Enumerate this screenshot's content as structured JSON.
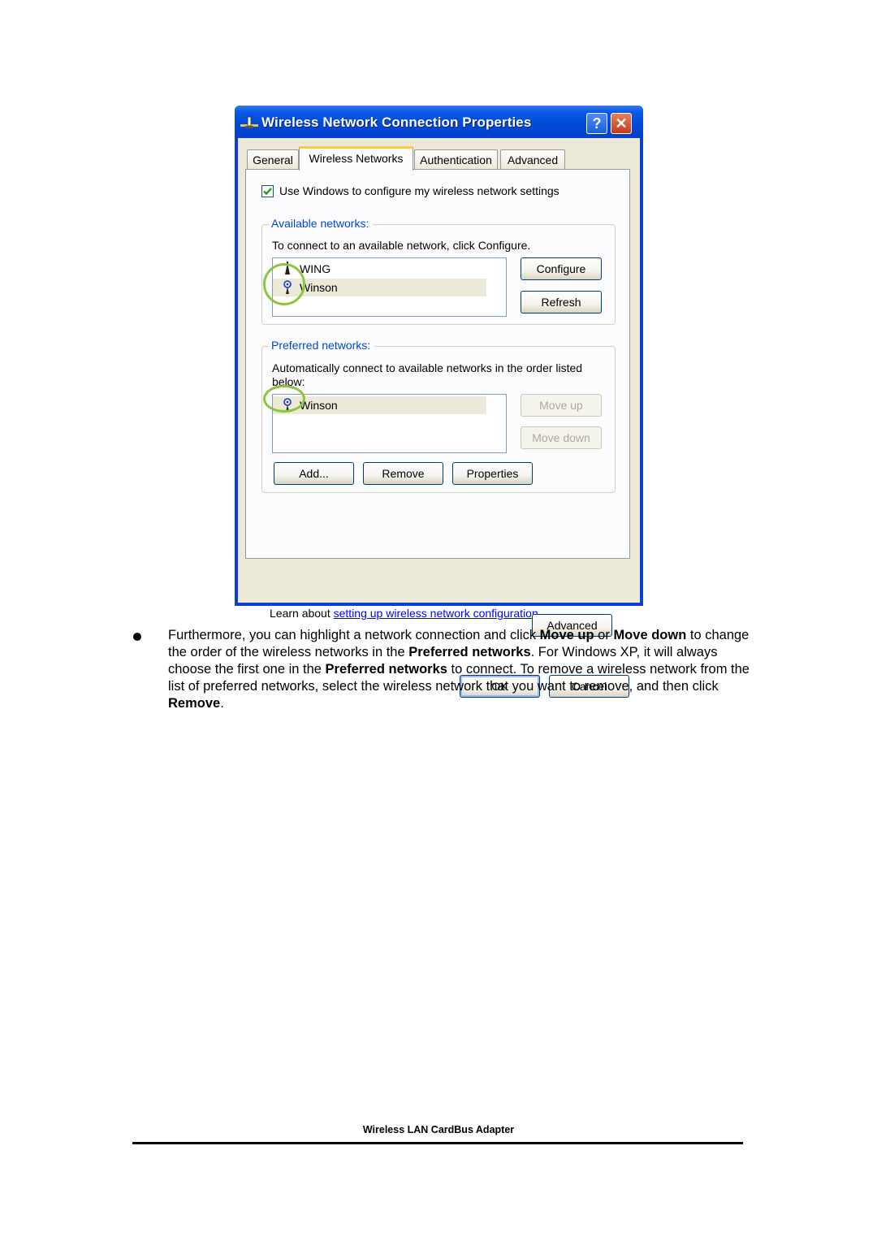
{
  "dialog": {
    "title": "Wireless Network Connection Properties",
    "help_label": "?",
    "close_label": "✕",
    "tabs": [
      {
        "label": "General",
        "active": false
      },
      {
        "label": "Wireless Networks",
        "active": true
      },
      {
        "label": "Authentication",
        "active": false
      },
      {
        "label": "Advanced",
        "active": false
      }
    ],
    "use_windows_checkbox": {
      "label": "Use Windows to configure my wireless network settings",
      "checked": true
    },
    "available": {
      "title": "Available networks:",
      "description": "To connect to an available network, click Configure.",
      "networks": [
        {
          "name": "WING",
          "icon": "antenna-icon",
          "selected": false
        },
        {
          "name": "Winson",
          "icon": "preferred-antenna-icon",
          "selected": true
        }
      ],
      "configure_label": "Configure",
      "refresh_label": "Refresh"
    },
    "preferred": {
      "title": "Preferred networks:",
      "description": "Automatically connect to available networks in the order listed below:",
      "networks": [
        {
          "name": "Winson",
          "icon": "preferred-antenna-icon",
          "selected": true
        }
      ],
      "move_up_label": "Move up",
      "move_down_label": "Move down",
      "add_label": "Add...",
      "remove_label": "Remove",
      "properties_label": "Properties"
    },
    "learn_prefix": "Learn about ",
    "learn_link": "setting up wireless network configuration.",
    "advanced_label": "Advanced",
    "ok_label": "OK",
    "cancel_label": "Cancel"
  },
  "document": {
    "paragraph": [
      {
        "text": "Furthermore, you can highlight a network connection and click ",
        "bold": false
      },
      {
        "text": "Move up",
        "bold": true
      },
      {
        "text": " or ",
        "bold": false
      },
      {
        "text": "Move down",
        "bold": true
      },
      {
        "text": " to change the order of the wireless networks in the ",
        "bold": false
      },
      {
        "text": "Preferred networks",
        "bold": true
      },
      {
        "text": ". For Windows XP, it will always choose the first one in the ",
        "bold": false
      },
      {
        "text": "Preferred networks",
        "bold": true
      },
      {
        "text": " to connect. To remove a wireless network from the list of preferred networks, select the wireless network that you want to remove, and then click ",
        "bold": false
      },
      {
        "text": "Remove",
        "bold": true
      },
      {
        "text": ".",
        "bold": false
      }
    ],
    "footer": "Wireless LAN CardBus Adapter"
  },
  "colors": {
    "annotation_circle": "#8cc63f",
    "group_title": "#0046d5",
    "link": "#0000ff"
  }
}
